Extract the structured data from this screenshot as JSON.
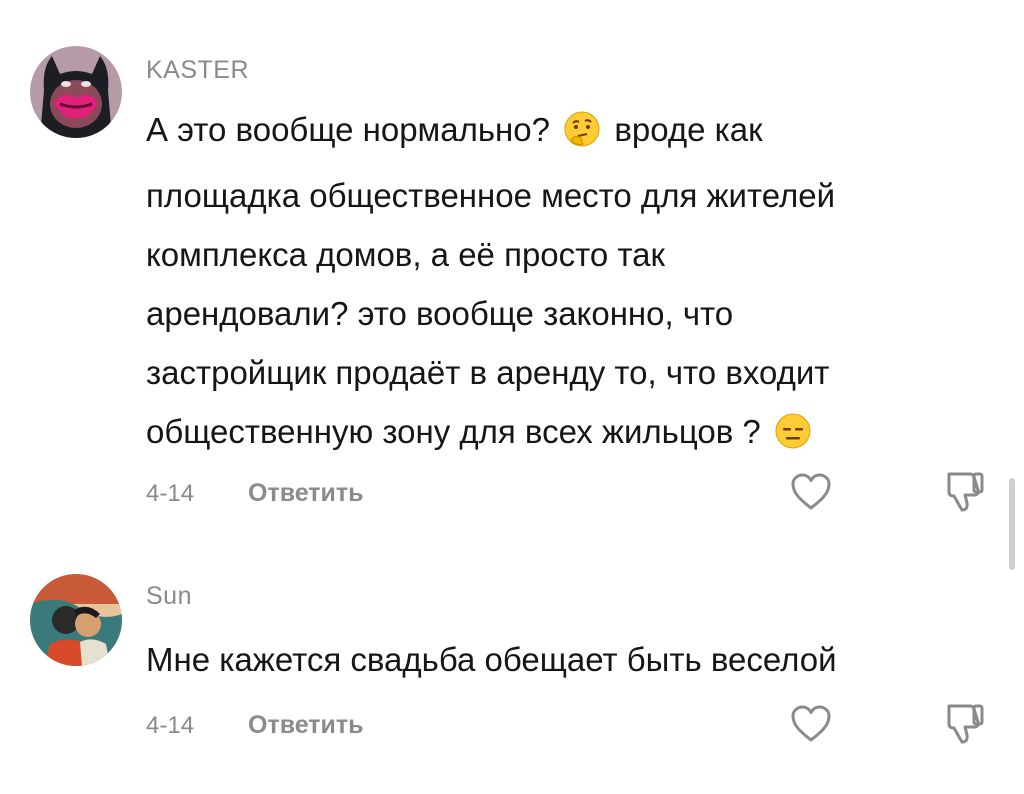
{
  "comments": [
    {
      "username": "KASTER",
      "avatar_icon": "batman-lips-avatar",
      "lines": [
        "А это вообще нормально? ",
        " вроде как",
        "площадка общественное место для жителей",
        "комплекса домов, а её просто так",
        "арендовали? это вообще законно, что",
        "застройщик продаёт в аренду то, что входит",
        "общественную зону для всех жильцов ? "
      ],
      "emojis": [
        "thinking-face-emoji",
        "expressionless-face-emoji"
      ],
      "date": "4-14",
      "reply_label": "Ответить",
      "like_icon": "heart-outline-icon",
      "dislike_icon": "thumbs-down-outline-icon"
    },
    {
      "username": "Sun",
      "avatar_icon": "couple-painting-avatar",
      "text": "Мне кажется свадьба обещает быть веселой",
      "date": "4-14",
      "reply_label": "Ответить",
      "like_icon": "heart-outline-icon",
      "dislike_icon": "thumbs-down-outline-icon"
    }
  ],
  "colors": {
    "text": "#161616",
    "secondary": "#8a8a8a",
    "background": "#ffffff",
    "scrollbar": "#cfcfcf"
  }
}
